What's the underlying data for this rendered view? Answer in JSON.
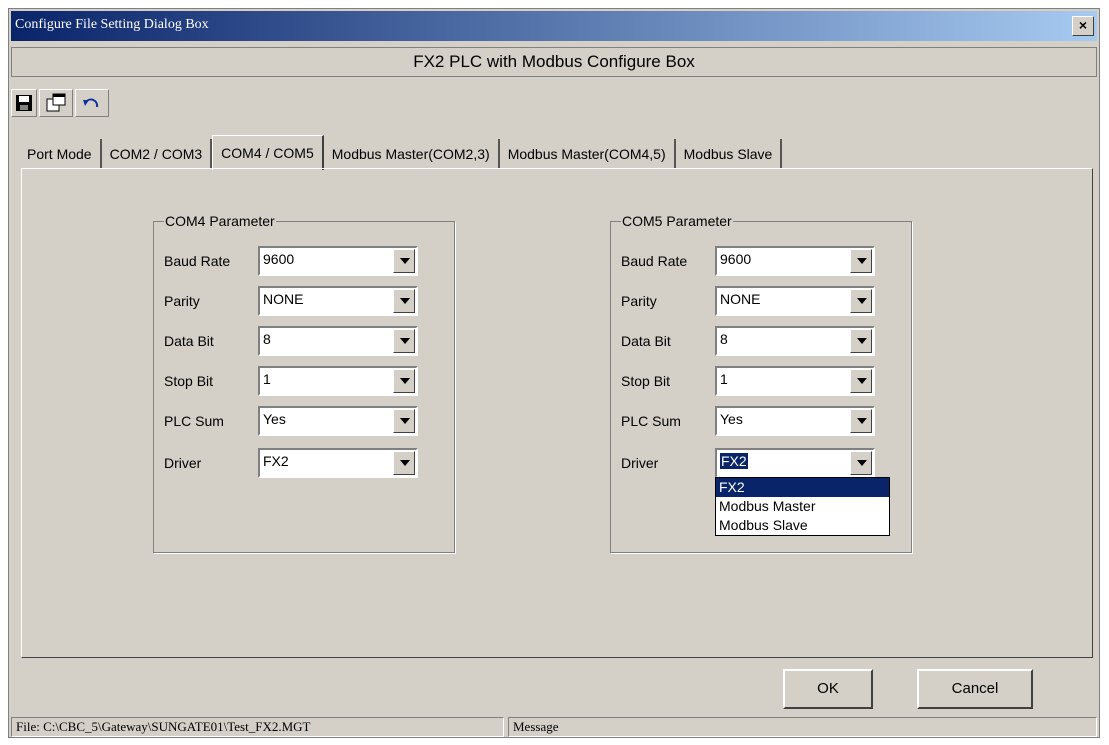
{
  "window": {
    "title": "Configure File Setting Dialog Box",
    "close": "×"
  },
  "header": {
    "title": "FX2 PLC with Modbus Configure Box"
  },
  "toolbar": {
    "icons": [
      "save-icon",
      "properties-icon",
      "undo-icon"
    ]
  },
  "tabs": [
    {
      "label": "Port Mode",
      "active": false
    },
    {
      "label": "COM2 / COM3",
      "active": false
    },
    {
      "label": "COM4 / COM5",
      "active": true
    },
    {
      "label": "Modbus Master(COM2,3)",
      "active": false
    },
    {
      "label": "Modbus Master(COM4,5)",
      "active": false
    },
    {
      "label": "Modbus Slave",
      "active": false
    }
  ],
  "com4": {
    "title": "COM4 Parameter",
    "baud_label": "Baud Rate",
    "baud": "9600",
    "parity_label": "Parity",
    "parity": "NONE",
    "databit_label": "Data Bit",
    "databit": "8",
    "stopbit_label": "Stop Bit",
    "stopbit": "1",
    "plcsum_label": "PLC Sum",
    "plcsum": "Yes",
    "driver_label": "Driver",
    "driver": "FX2"
  },
  "com5": {
    "title": "COM5 Parameter",
    "baud_label": "Baud Rate",
    "baud": "9600",
    "parity_label": "Parity",
    "parity": "NONE",
    "databit_label": "Data Bit",
    "databit": "8",
    "stopbit_label": "Stop Bit",
    "stopbit": "1",
    "plcsum_label": "PLC Sum",
    "plcsum": "Yes",
    "driver_label": "Driver",
    "driver": "FX2",
    "driver_options": [
      "FX2",
      "Modbus Master",
      "Modbus Slave"
    ]
  },
  "buttons": {
    "ok": "OK",
    "cancel": "Cancel"
  },
  "status": {
    "file": "File: C:\\CBC_5\\Gateway\\SUNGATE01\\Test_FX2.MGT",
    "message": "Message"
  },
  "colors": {
    "titlebar_start": "#0a246a",
    "titlebar_end": "#a6caf0",
    "face": "#d4d0c8",
    "highlight": "#0a246a"
  }
}
